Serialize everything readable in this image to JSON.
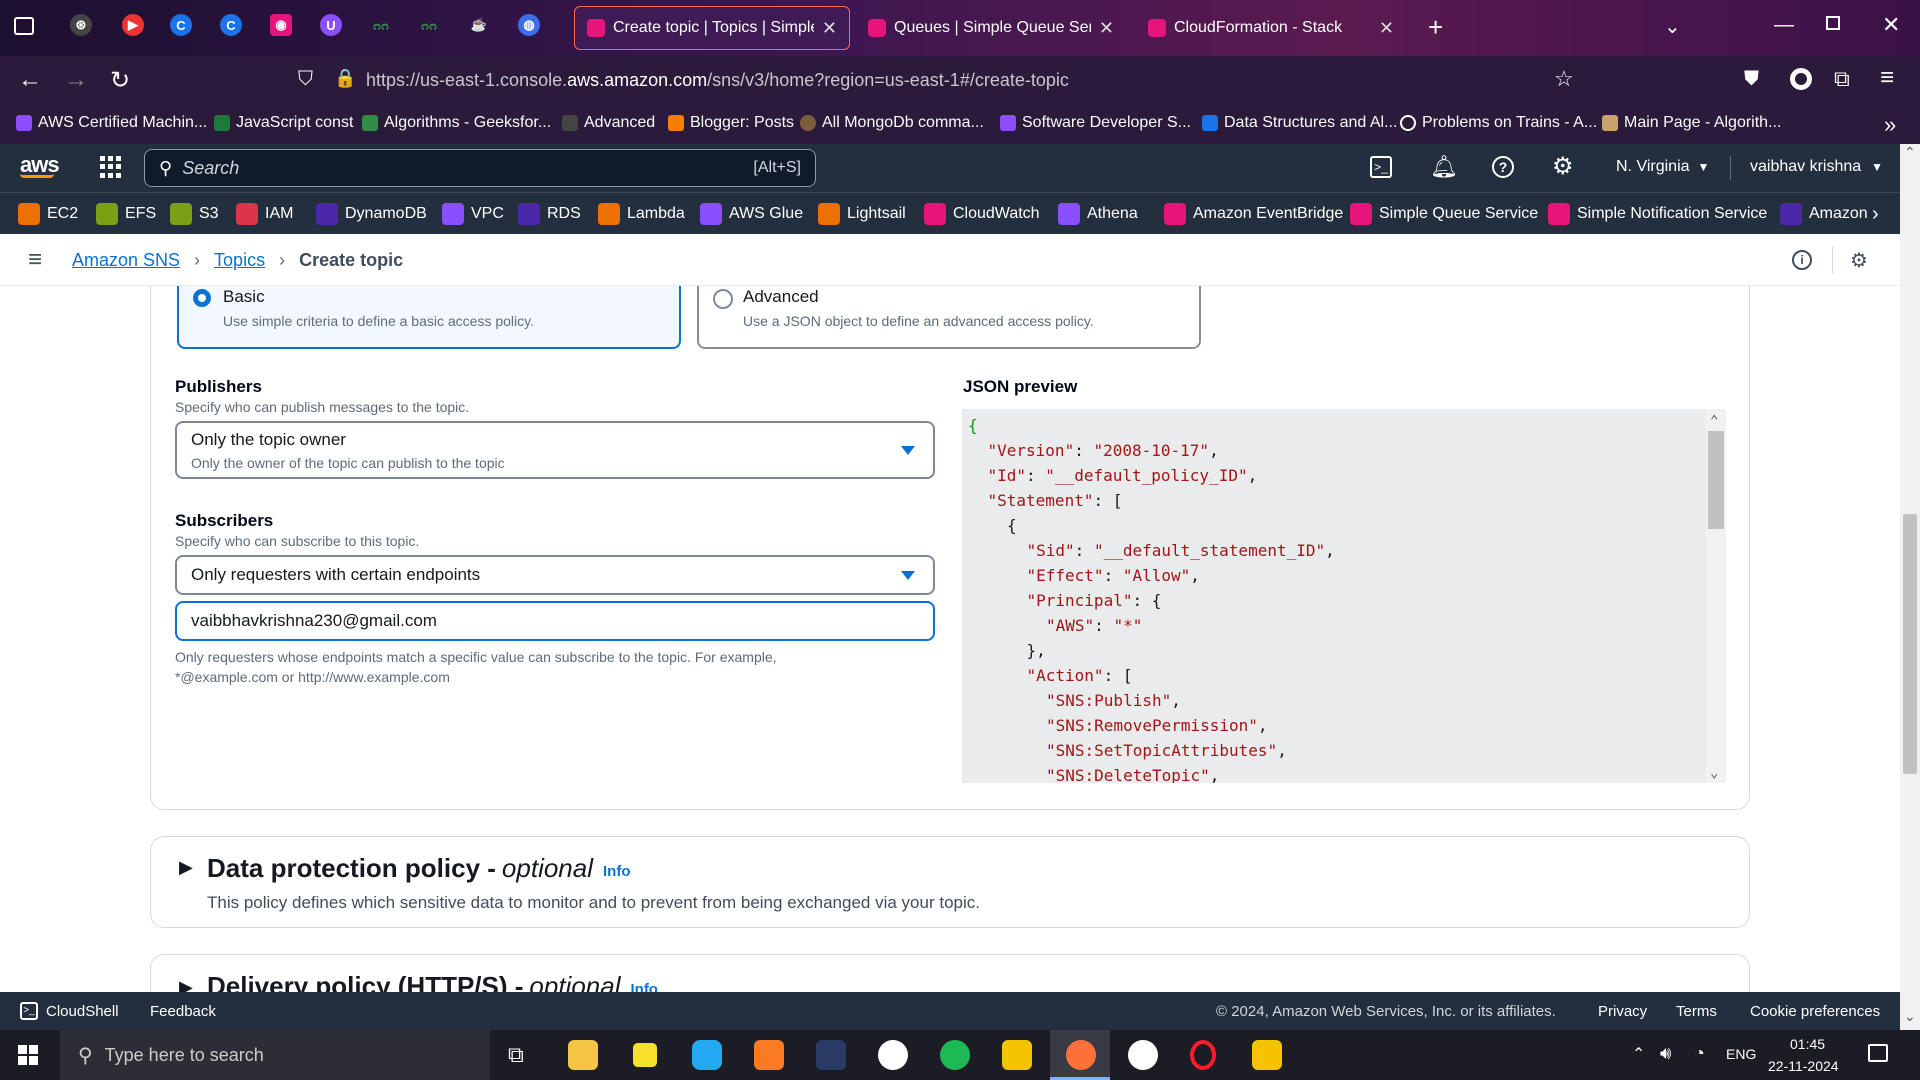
{
  "browser": {
    "tabs": [
      {
        "title": "Create topic | Topics | Simple N",
        "active": true
      },
      {
        "title": "Queues | Simple Queue Service",
        "active": false
      },
      {
        "title": "CloudFormation - Stack",
        "active": false
      }
    ],
    "url_prefix": "https://us-east-1.console.",
    "url_domain": "aws.amazon.com",
    "url_path": "/sns/v3/home?region=us-east-1#/create-topic",
    "bookmarks": [
      "AWS Certified Machin...",
      "JavaScript const",
      "Algorithms - Geeksfor...",
      "Advanced",
      "Blogger: Posts",
      "All MongoDb comma...",
      "Software Developer S...",
      "Data Structures and Al...",
      "Problems on Trains - A...",
      "Main Page - Algorith..."
    ]
  },
  "aws": {
    "search_placeholder": "Search",
    "search_shortcut": "[Alt+S]",
    "region": "N. Virginia",
    "user": "vaibhav krishna",
    "services": [
      "EC2",
      "EFS",
      "S3",
      "IAM",
      "DynamoDB",
      "VPC",
      "RDS",
      "Lambda",
      "AWS Glue",
      "Lightsail",
      "CloudWatch",
      "Athena",
      "Amazon EventBridge",
      "Simple Queue Service",
      "Simple Notification Service",
      "Amazon"
    ],
    "service_colors": [
      "#ed7100",
      "#7aa116",
      "#7aa116",
      "#dd344c",
      "#4d27aa",
      "#8c4fff",
      "#4d27aa",
      "#ed7100",
      "#8c4fff",
      "#ed7100",
      "#e7157b",
      "#8c4fff",
      "#e7157b",
      "#e7157b",
      "#e7157b",
      "#4d27aa"
    ]
  },
  "breadcrumb": {
    "home": "Amazon SNS",
    "topics": "Topics",
    "current": "Create topic"
  },
  "access_policy": {
    "basic_title": "Basic",
    "basic_desc": "Use simple criteria to define a basic access policy.",
    "advanced_title": "Advanced",
    "advanced_desc": "Use a JSON object to define an advanced access policy.",
    "publishers_label": "Publishers",
    "publishers_desc": "Specify who can publish messages to the topic.",
    "publishers_value": "Only the topic owner",
    "publishers_value_desc": "Only the owner of the topic can publish to the topic",
    "subscribers_label": "Subscribers",
    "subscribers_desc": "Specify who can subscribe to this topic.",
    "subscribers_value": "Only requesters with certain endpoints",
    "endpoint_value": "vaibbhavkrishna230@gmail.com",
    "endpoint_hint_1": "Only requesters whose endpoints match a specific value can subscribe to the topic. For example,",
    "endpoint_hint_2": "*@example.com or http://www.example.com",
    "json_label": "JSON preview",
    "json_lines": [
      {
        "indent": 0,
        "parts": [
          [
            "b",
            "{"
          ]
        ]
      },
      {
        "indent": 1,
        "parts": [
          [
            "k",
            "\"Version\""
          ],
          [
            "p",
            ": "
          ],
          [
            "k",
            "\"2008-10-17\""
          ],
          [
            "p",
            ","
          ]
        ]
      },
      {
        "indent": 1,
        "parts": [
          [
            "k",
            "\"Id\""
          ],
          [
            "p",
            ": "
          ],
          [
            "k",
            "\"__default_policy_ID\""
          ],
          [
            "p",
            ","
          ]
        ]
      },
      {
        "indent": 1,
        "parts": [
          [
            "k",
            "\"Statement\""
          ],
          [
            "p",
            ": ["
          ]
        ]
      },
      {
        "indent": 2,
        "parts": [
          [
            "p",
            "{"
          ]
        ]
      },
      {
        "indent": 3,
        "parts": [
          [
            "k",
            "\"Sid\""
          ],
          [
            "p",
            ": "
          ],
          [
            "k",
            "\"__default_statement_ID\""
          ],
          [
            "p",
            ","
          ]
        ]
      },
      {
        "indent": 3,
        "parts": [
          [
            "k",
            "\"Effect\""
          ],
          [
            "p",
            ": "
          ],
          [
            "k",
            "\"Allow\""
          ],
          [
            "p",
            ","
          ]
        ]
      },
      {
        "indent": 3,
        "parts": [
          [
            "k",
            "\"Principal\""
          ],
          [
            "p",
            ": {"
          ]
        ]
      },
      {
        "indent": 4,
        "parts": [
          [
            "k",
            "\"AWS\""
          ],
          [
            "p",
            ": "
          ],
          [
            "k",
            "\"*\""
          ]
        ]
      },
      {
        "indent": 3,
        "parts": [
          [
            "p",
            "},"
          ]
        ]
      },
      {
        "indent": 3,
        "parts": [
          [
            "k",
            "\"Action\""
          ],
          [
            "p",
            ": ["
          ]
        ]
      },
      {
        "indent": 4,
        "parts": [
          [
            "k",
            "\"SNS:Publish\""
          ],
          [
            "p",
            ","
          ]
        ]
      },
      {
        "indent": 4,
        "parts": [
          [
            "k",
            "\"SNS:RemovePermission\""
          ],
          [
            "p",
            ","
          ]
        ]
      },
      {
        "indent": 4,
        "parts": [
          [
            "k",
            "\"SNS:SetTopicAttributes\""
          ],
          [
            "p",
            ","
          ]
        ]
      },
      {
        "indent": 4,
        "parts": [
          [
            "k",
            "\"SNS:DeleteTopic\""
          ],
          [
            "p",
            ","
          ]
        ]
      }
    ]
  },
  "data_protection": {
    "title": "Data protection policy - ",
    "optional": "optional",
    "info": "Info",
    "desc": "This policy defines which sensitive data to monitor and to prevent from being exchanged via your topic."
  },
  "delivery_policy": {
    "title": "Delivery policy (HTTP/S) - ",
    "optional": "optional",
    "info": "Info"
  },
  "footer": {
    "cloudshell": "CloudShell",
    "feedback": "Feedback",
    "copyright": "© 2024, Amazon Web Services, Inc. or its affiliates.",
    "privacy": "Privacy",
    "terms": "Terms",
    "cookie": "Cookie preferences"
  },
  "taskbar": {
    "search_placeholder": "Type here to search",
    "lang": "ENG",
    "time": "01:45",
    "date": "22-11-2024"
  }
}
